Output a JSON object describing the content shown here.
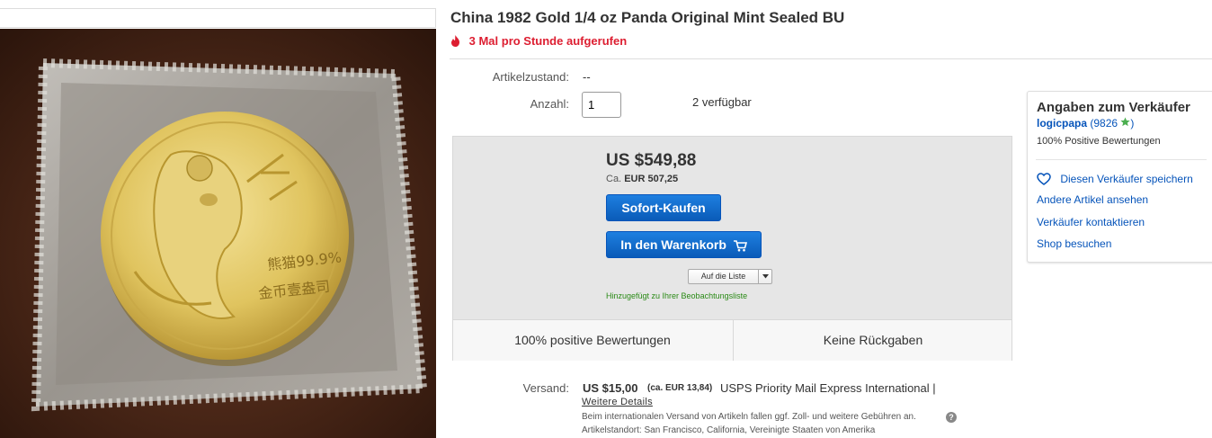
{
  "product": {
    "title": "China 1982 Gold 1/4 oz Panda Original Mint Sealed BU",
    "views": "3 Mal pro Stunde aufgerufen"
  },
  "details": {
    "condition_label": "Artikelzustand:",
    "condition_value": "--",
    "quantity_label": "Anzahl:",
    "quantity_value": "1",
    "available": "2 verfügbar"
  },
  "buy_box": {
    "price": "US $549,88",
    "approx_prefix": "Ca.",
    "approx_value": "EUR 507,25",
    "buy_now_label": "Sofort-Kaufen",
    "cart_label": "In den Warenkorb",
    "watchlist_label": "Auf die Liste",
    "watchlist_added": "Hinzugefügt zu Ihrer Beobachtungsliste",
    "highlights": [
      "100% positive Bewertungen",
      "Keine Rückgaben"
    ]
  },
  "shipping": {
    "label": "Versand:",
    "price": "US $15,00",
    "approx": "(ca. EUR 13,84)",
    "service": "USPS Priority Mail Express International |",
    "more_details": "Weitere Details",
    "customs_note": "Beim internationalen Versand von Artikeln fallen ggf. Zoll- und weitere Gebühren an.",
    "help_glyph": "?",
    "location_label": "Artikelstandort:",
    "location_value": "San Francisco, California, Vereinigte Staaten von Amerika"
  },
  "seller": {
    "heading": "Angaben zum Verkäufer",
    "name": "logicpapa",
    "score_open": "(9826",
    "score_close": ")",
    "positive": "100% Positive Bewertungen",
    "save_link": "Diesen Verkäufer speichern",
    "other_items_link": "Andere Artikel ansehen",
    "contact_link": "Verkäufer kontaktieren",
    "store_link": "Shop besuchen"
  },
  "image": {
    "coin_text_1": "熊猫99.9%",
    "coin_text_2": "金币壹盎司"
  },
  "colors": {
    "link": "#0654ba",
    "alert": "#dd1e31",
    "success": "#2a8a16",
    "button": "#0a5bb8",
    "star": "#4caf50"
  },
  "icons": [
    "flame-icon",
    "cart-icon",
    "chevron-down-icon",
    "heart-icon",
    "star-icon",
    "help-icon"
  ]
}
